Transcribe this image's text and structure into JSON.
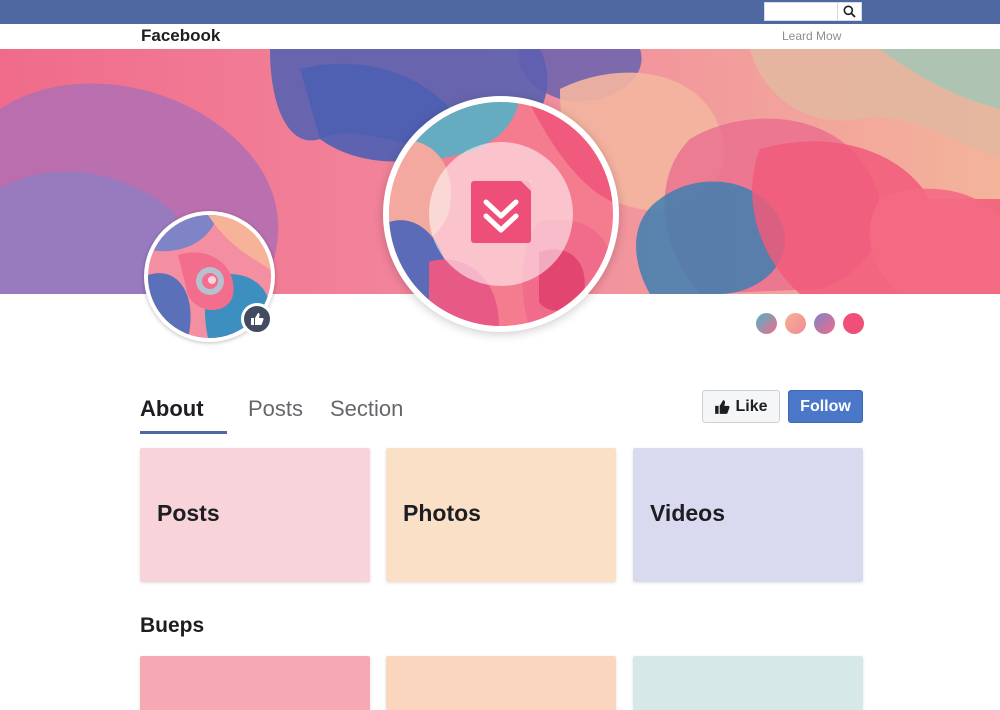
{
  "header": {
    "brand": "Facebook",
    "learn_more": "Leard Mow",
    "search": {
      "value": "",
      "placeholder": ""
    },
    "bar_color": "#4e69a2"
  },
  "icons": {
    "search": "search-icon",
    "avatar_badge": "thumbs-up-icon",
    "center_logo": "chevron-down-double-icon",
    "like": "thumbs-up-icon"
  },
  "profile_dots": [
    {
      "color": "#4fb3c8"
    },
    {
      "color": "#f0b487"
    },
    {
      "color": "#b571a8"
    },
    {
      "color": "#ef4f78"
    }
  ],
  "tabs": [
    {
      "label": "About",
      "active": true
    },
    {
      "label": "Posts",
      "active": false
    },
    {
      "label": "Section",
      "active": false
    }
  ],
  "actions": {
    "like_label": "Like",
    "follow_label": "Follow",
    "follow_color": "#4a77c7"
  },
  "cards": [
    {
      "label": "Posts",
      "color": "#f8d3da"
    },
    {
      "label": "Photos",
      "color": "#fbe0c8"
    },
    {
      "label": "Videos",
      "color": "#d9daf0"
    }
  ],
  "section": {
    "title": "Bueps",
    "cards": [
      {
        "label": "",
        "color": "#f4a9b3"
      },
      {
        "label": "",
        "color": "#fbd6bf"
      },
      {
        "label": "",
        "color": "#d7e9e6"
      }
    ]
  }
}
